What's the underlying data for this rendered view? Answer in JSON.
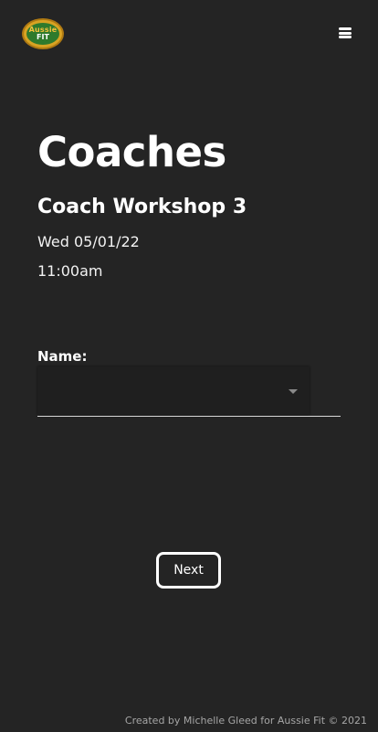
{
  "header": {
    "logo_top": "Aussie",
    "logo_bottom": "FIT",
    "menu_icon": "hamburger-menu-icon"
  },
  "main": {
    "page_title": "Coaches",
    "event_title": "Coach Workshop 3",
    "event_date": "Wed 05/01/22",
    "event_time": "11:00am"
  },
  "form": {
    "name_label": "Name:",
    "name_value": "",
    "next_label": "Next"
  },
  "footer": {
    "credit": "Created by Michelle Gleed for Aussie Fit © 2021"
  },
  "colors": {
    "background": "#242424",
    "text": "#ffffff",
    "logo_gold": "#d8a323",
    "logo_green": "#2f7a2c",
    "footer_text": "#a6a6a6"
  }
}
